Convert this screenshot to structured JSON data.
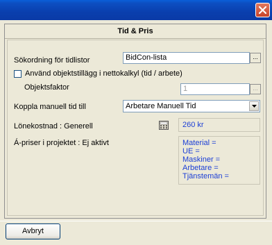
{
  "window": {
    "close_label": "X"
  },
  "panel": {
    "title": "Tid & Pris"
  },
  "form": {
    "sort_order_label": "Sökordning för tidlistor",
    "sort_order_value": "BidCon-lista",
    "use_object_surcharge_label": "Använd objektstillägg i nettokalkyl (tid / arbete)",
    "use_object_surcharge_checked": false,
    "object_factor_label": "Objektsfaktor",
    "object_factor_value": "1",
    "manual_time_label": "Koppla manuell tid till",
    "manual_time_value": "Arbetare Manuell Tid",
    "wage_cost_label": "Lönekostnad : Generell",
    "wage_cost_value": "260 kr",
    "unit_prices_label": "Á-priser i projektet : Ej aktivt",
    "unit_prices": [
      "Material =",
      "UE =",
      "Maskiner =",
      "Arbetare =",
      "Tjänstemän ="
    ],
    "ellipsis": "..."
  },
  "footer": {
    "cancel_label": "Avbryt"
  },
  "colors": {
    "titlebar": "#0a3fae",
    "value_text": "#1b3ed6",
    "background": "#ece9d8"
  },
  "icons": {
    "close": "close-icon",
    "dropdown": "chevron-down-icon",
    "calculator": "calculator-icon"
  }
}
